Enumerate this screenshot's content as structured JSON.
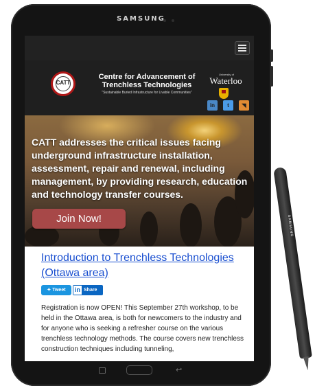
{
  "device": {
    "brand": "SAMSUNG"
  },
  "header": {
    "title": "Centre for Advancement of Trenchless Technologies",
    "tagline": "\"Sustainable Buried Infrastructure for Livable Communities\"",
    "logo_text": "CATT",
    "university_small": "University of",
    "university_name": "Waterloo"
  },
  "social": [
    {
      "icon": "linkedin-icon",
      "label": "in",
      "color": "#4a88c7"
    },
    {
      "icon": "twitter-icon",
      "label": "t",
      "color": "#4a9be8"
    },
    {
      "icon": "rss-icon",
      "label": "◥",
      "color": "#e28b33"
    }
  ],
  "hero": {
    "text": "CATT addresses the critical issues facing underground infrastructure installation, assessment, repair and renewal, including management, by providing research, education and technology transfer courses.",
    "button_label": "Join Now!"
  },
  "article": {
    "title": "Introduction to Trenchless Technologies (Ottawa area)",
    "tweet_label": "Tweet",
    "share_label": "Share",
    "share_icon_label": "in",
    "body": "Registration is now OPEN! This September 27th workshop, to be held in the Ottawa area, is both for newcomers to the industry and for anyone who is seeking a refresher course on the various trenchless technology methods. The course covers new trenchless construction techniques including tunneling,"
  },
  "stylus": {
    "label": "SAMSUNG"
  },
  "colors": {
    "accent_link": "#1a4fd0",
    "join_button": "#a74848",
    "header_bg": "#1f1f1f"
  }
}
